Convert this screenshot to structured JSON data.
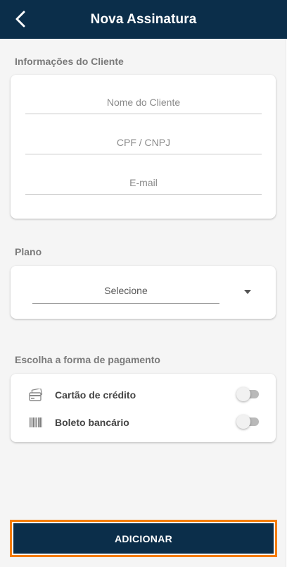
{
  "header": {
    "title": "Nova Assinatura",
    "back_icon": "chevron-left-icon"
  },
  "client_section": {
    "label": "Informações do Cliente",
    "fields": [
      {
        "placeholder": "Nome do Cliente",
        "value": ""
      },
      {
        "placeholder": "CPF / CNPJ",
        "value": ""
      },
      {
        "placeholder": "E-mail",
        "value": ""
      }
    ]
  },
  "plan_section": {
    "label": "Plano",
    "select_value": "Selecione",
    "dropdown_icon": "caret-down-icon"
  },
  "payment_section": {
    "label": "Escolha a forma de pagamento",
    "options": [
      {
        "label": "Cartão de crédito",
        "icon": "credit-card-icon",
        "enabled": false
      },
      {
        "label": "Boleto bancário",
        "icon": "barcode-icon",
        "enabled": false
      }
    ]
  },
  "footer": {
    "add_label": "ADICIONAR"
  },
  "colors": {
    "header_bg": "#0b2e4a",
    "button_bg": "#0b2e4a",
    "button_outline": "#f57c00",
    "page_bg": "#f5f5f5"
  }
}
